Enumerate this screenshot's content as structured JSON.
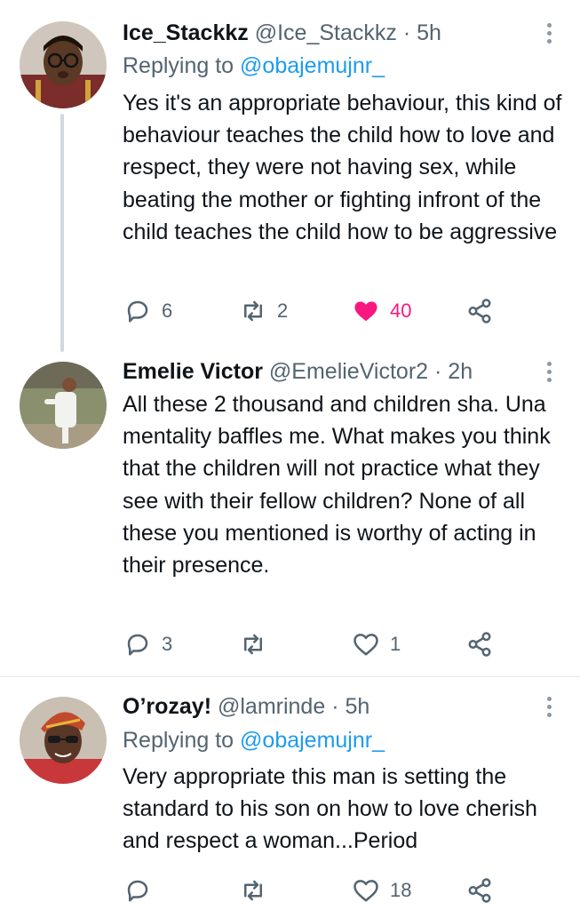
{
  "tweets": [
    {
      "name": "Ice_Stackkz",
      "handle": "@Ice_Stackkz",
      "separator": "·",
      "time": "5h",
      "replying_prefix": "Replying to",
      "replying_to": "@obajemujnr_",
      "body": "Yes it's an appropriate behaviour, this kind of behaviour teaches the child how to love and respect, they were not having sex, while beating the mother or fighting infront of the child teaches the child how to be aggressive",
      "replies": "6",
      "retweets": "2",
      "likes": "40",
      "liked": true
    },
    {
      "name": "Emelie Victor",
      "handle": "@EmelieVictor2",
      "separator": "·",
      "time": "2h",
      "body": "All these 2 thousand and children sha. Una mentality baffles me. What makes you think that the children will not practice what they see with their fellow children? None of all these you mentioned is worthy of acting in their presence.",
      "replies": "3",
      "retweets": "",
      "likes": "1",
      "liked": false
    },
    {
      "name": "O’rozay!",
      "handle": "@lamrinde",
      "separator": "·",
      "time": "5h",
      "replying_prefix": "Replying to",
      "replying_to": "@obajemujnr_",
      "body": "Very appropriate this man is setting the standard to his son on how to love cherish and respect a woman...Period",
      "replies": "",
      "retweets": "",
      "likes": "18",
      "liked": false
    }
  ],
  "icons": [
    "reply-icon",
    "retweet-icon",
    "like-icon",
    "share-icon",
    "more-icon"
  ],
  "colors": {
    "link": "#1d9bf0",
    "like": "#f91880",
    "muted": "#536471",
    "text": "#0f1419"
  }
}
